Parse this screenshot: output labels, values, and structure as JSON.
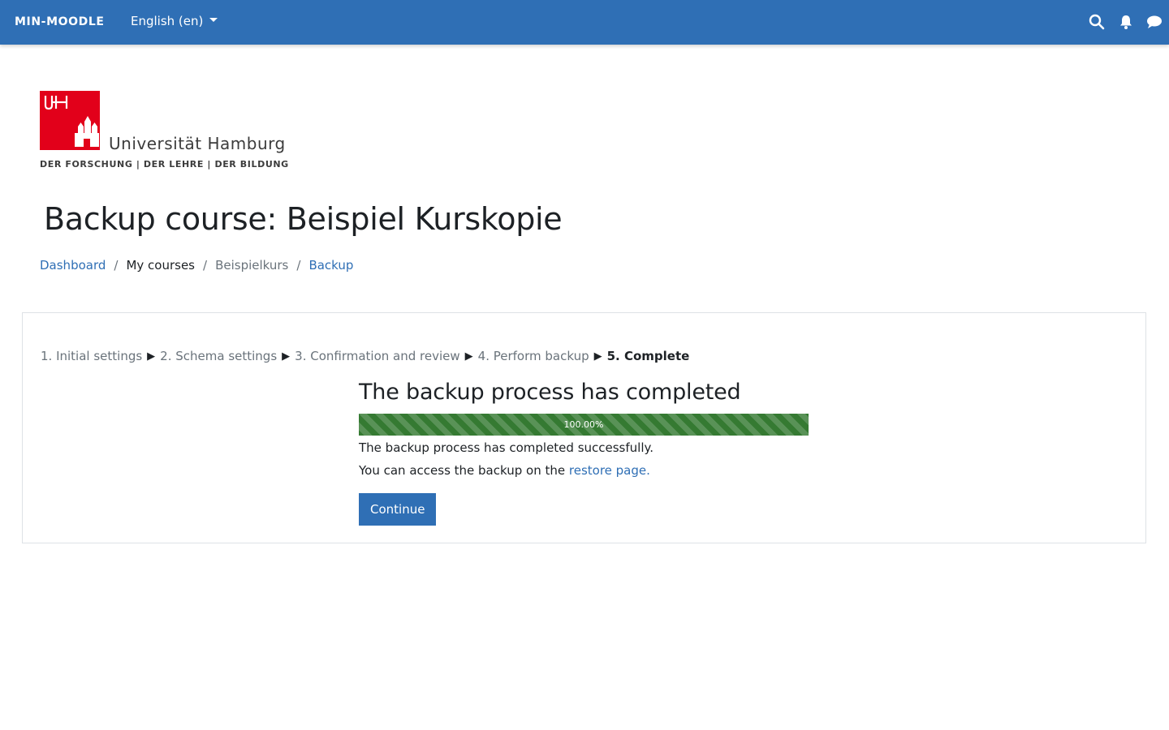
{
  "navbar": {
    "brand": "MIN-MOODLE",
    "language": "English (en)",
    "icons": [
      "search-icon",
      "bell-icon",
      "chat-icon"
    ],
    "background": "#2f6fb5"
  },
  "logo": {
    "mark_text": "UHH",
    "name": "Universität Hamburg",
    "tagline": "DER FORSCHUNG  |  DER LEHRE  |  DER BILDUNG"
  },
  "page": {
    "title": "Backup course: Beispiel Kurskopie"
  },
  "breadcrumb": {
    "items": [
      {
        "label": "Dashboard",
        "link": true
      },
      {
        "label": "My courses",
        "link": false
      },
      {
        "label": "Beispielkurs",
        "link": false
      },
      {
        "label": "Backup",
        "link": true
      }
    ],
    "separator": "/"
  },
  "steps": {
    "items": [
      "1. Initial settings",
      "2. Schema settings",
      "3. Confirmation and review",
      "4. Perform backup",
      "5. Complete"
    ],
    "separator": "▶",
    "current_index": 4
  },
  "result": {
    "heading": "The backup process has completed",
    "progress_percent": 100,
    "progress_label": "100.00%",
    "success_message": "The backup process has completed successfully.",
    "access_prefix": "You can access the backup on the",
    "restore_link": "restore page.",
    "continue_label": "Continue"
  },
  "colors": {
    "accent": "#2f6fb5",
    "progress": "#357a32",
    "uhh_red": "#e2001a"
  }
}
